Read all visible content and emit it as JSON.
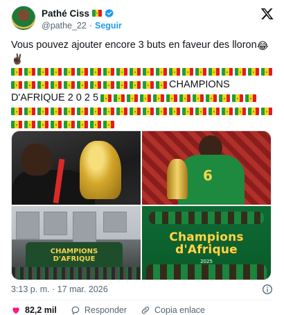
{
  "author": {
    "display_name": "Pathé Ciss",
    "handle": "@pathe_22",
    "separator": "·",
    "follow_label": "Seguir"
  },
  "tweet": {
    "line1": "Vous pouvez ajouter encore 3 buts en faveur des lloron",
    "line1_emoji": "😂",
    "line2_emoji": "✌🏿",
    "champ_line1": "CHAMPIONS",
    "champ_line2_prefix": "D'AFRIQUE 2 0 2 5"
  },
  "media": {
    "tile3_text": "CHAMPIONS D'AFRIQUE",
    "tile4_title": "Champions d'Afrique",
    "tile4_year": "2025",
    "tile2_number": "6"
  },
  "footer": {
    "timestamp": "3:13 p. m. · 17 mar. 2026",
    "likes": "82,2 mil",
    "reply_label": "Responder",
    "copy_link_label": "Copia enlace"
  },
  "colors": {
    "accent": "#1d9bf0",
    "like": "#f91880",
    "text_secondary": "#536471"
  }
}
